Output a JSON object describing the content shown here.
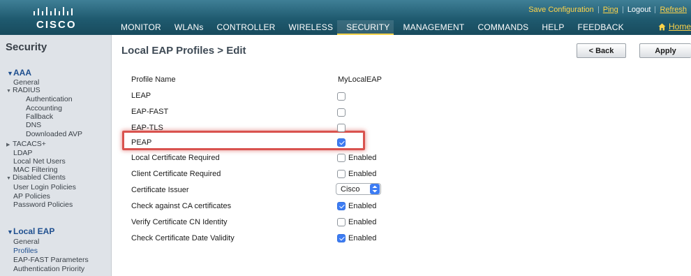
{
  "header": {
    "brand": "cisco",
    "util_links": [
      "Save Configuration",
      "Ping",
      "Logout",
      "Refresh"
    ],
    "menu": [
      "MONITOR",
      "WLANs",
      "CONTROLLER",
      "WIRELESS",
      "SECURITY",
      "MANAGEMENT",
      "COMMANDS",
      "HELP",
      "FEEDBACK"
    ],
    "active_menu": "SECURITY",
    "home": "Home"
  },
  "sidebar": {
    "title": "Security",
    "aaa": "AAA",
    "general": "General",
    "radius": "RADIUS",
    "authentication": "Authentication",
    "accounting": "Accounting",
    "fallback": "Fallback",
    "dns": "DNS",
    "downloaded_avp": "Downloaded AVP",
    "tacacs": "TACACS+",
    "ldap": "LDAP",
    "local_net_users": "Local Net Users",
    "mac_filtering": "MAC Filtering",
    "disabled_clients": "Disabled Clients",
    "user_login_policies": "User Login Policies",
    "ap_policies": "AP Policies",
    "password_policies": "Password Policies",
    "local_eap": "Local EAP",
    "leap_general": "General",
    "profiles": "Profiles",
    "eap_fast_params": "EAP-FAST Parameters",
    "auth_priority": "Authentication Priority"
  },
  "main": {
    "title": "Local EAP Profiles > Edit",
    "back": "< Back",
    "apply": "Apply",
    "profile_name_label": "Profile Name",
    "profile_name_value": "MyLocalEAP",
    "leap": "LEAP",
    "eap_fast": "EAP-FAST",
    "eap_tls": "EAP-TLS",
    "peap": "PEAP",
    "local_cert_required": "Local Certificate Required",
    "client_cert_required": "Client Certificate Required",
    "cert_issuer": "Certificate Issuer",
    "cert_issuer_value": "Cisco",
    "check_ca": "Check against CA certificates",
    "verify_cn": "Verify Certificate CN Identity",
    "check_date": "Check Certificate Date Validity",
    "enabled": "Enabled",
    "states": {
      "leap": false,
      "eap_fast": false,
      "eap_tls": false,
      "peap": true,
      "local_cert_required": false,
      "client_cert_required": false,
      "check_ca": true,
      "verify_cn": false,
      "check_date": true
    }
  }
}
